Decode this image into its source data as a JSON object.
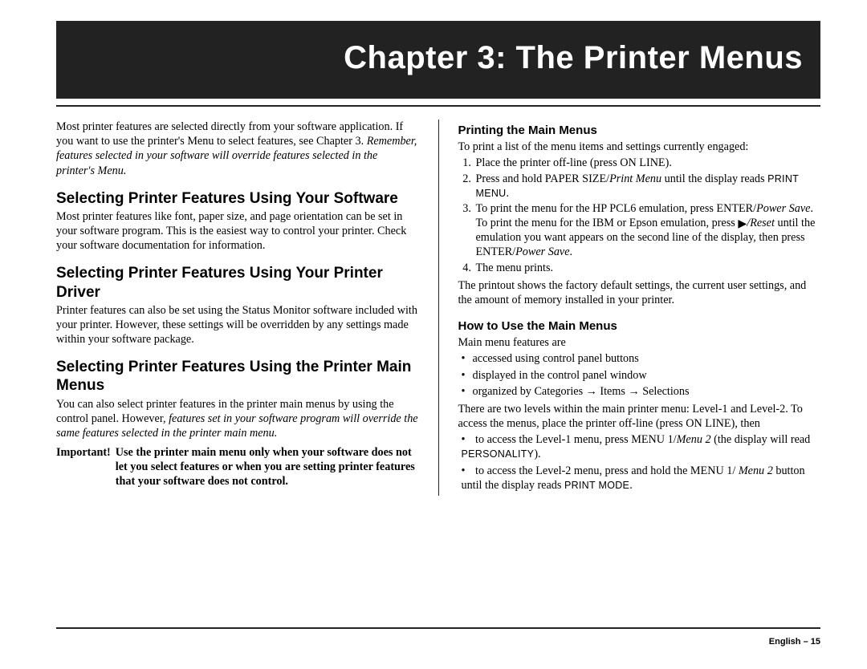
{
  "banner": "Chapter 3: The Printer Menus",
  "left": {
    "intro_a": "Most printer features are selected directly from your software application. If you want to use the printer's Menu to select features, see Chapter 3. ",
    "intro_b_italic": "Remember, features selected in your software will override features selected in the printer's Menu.",
    "h_software": "Selecting Printer Features Using Your Software",
    "p_software": "Most printer features like font, paper size, and page orientation can be set in your software program. This is the easiest way to control your printer. Check your software documentation for information.",
    "h_driver": "Selecting Printer Features Using Your Printer Driver",
    "p_driver": "Printer features can also be set using the Status Monitor software included with your printer. However, these settings will be overridden by any settings made within your software package.",
    "h_main": "Selecting Printer Features Using the Printer Main Menus",
    "p_main_a": "You can also select printer features in the printer main menus by using the control panel. However, ",
    "p_main_b_italic": "features set in your software program will override the same features selected in the printer main menu.",
    "important_label": "Important!",
    "important_text": "Use the printer main menu only when your software does not let you select features or when you are setting printer features that your software does not control."
  },
  "right": {
    "h_printing": "Printing the Main Menus",
    "p_printing_intro": "To print a list of the menu items and settings currently engaged:",
    "step1": "Place the printer off-line (press ON LINE).",
    "step2_a": "Press and hold PAPER SIZE/",
    "step2_b_italic": "Print Menu",
    "step2_c": " until the display reads ",
    "step2_d_mono": "PRINT MENU",
    "step2_e": ".",
    "step3_a": "To print the menu for the HP PCL6 emulation, press ENTER/",
    "step3_b_italic": "Power Save",
    "step3_c": ". To print the menu for the IBM or Epson emulation, press ",
    "step3_play": "▶",
    "step3_d_italic": "/Reset",
    "step3_e": " until the emulation you want appears on the second line of the display, then press ENTER/",
    "step3_f_italic": "Power Save",
    "step3_g": ".",
    "step4": "The menu prints.",
    "p_printout": "The printout shows the factory default settings, the current user settings, and the amount of memory installed in your printer.",
    "h_howto": "How to Use the Main Menus",
    "p_howto_intro": "Main menu features are",
    "b1": "accessed using control panel buttons",
    "b2": "displayed in the control panel window",
    "b3": "organized by Categories → Items → Selections",
    "p_levels": "There are two levels within the main printer menu: Level-1 and Level-2. To access the menus, place the printer off-line (press ON LINE), then",
    "lb1_a": "to access the Level-1 menu, press MENU 1/",
    "lb1_b_italic": "Menu 2",
    "lb1_c": " (the display will read ",
    "lb1_d_mono": "PERSONALITY",
    "lb1_e": ").",
    "lb2_a": "to access the Level-2 menu, press and hold the MENU 1/ ",
    "lb2_b_italic": "Menu 2",
    "lb2_c": " button until the display reads ",
    "lb2_d_mono": "PRINT MODE",
    "lb2_e": "."
  },
  "footer": "English – 15"
}
